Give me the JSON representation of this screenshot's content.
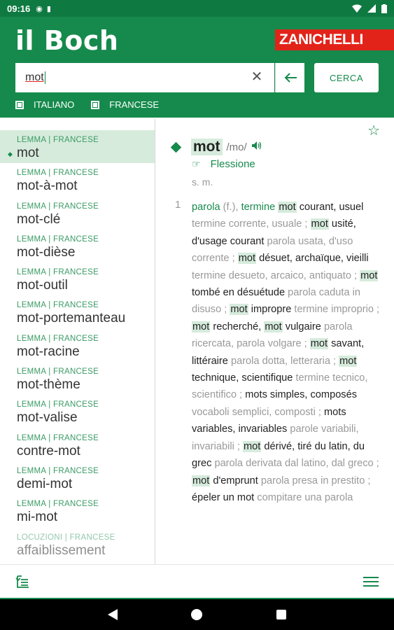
{
  "status_bar": {
    "time": "09:16"
  },
  "header": {
    "app_title": "il Boch",
    "brand": "ZANICHELLI",
    "search": {
      "value": "mot",
      "button_label": "CERCA"
    },
    "filters": [
      {
        "label": "ITALIANO"
      },
      {
        "label": "FRANCESE"
      }
    ]
  },
  "lemmas": [
    {
      "tag": "LEMMA | FRANCESE",
      "word": "mot",
      "active": true
    },
    {
      "tag": "LEMMA | FRANCESE",
      "word": "mot-à-mot"
    },
    {
      "tag": "LEMMA | FRANCESE",
      "word": "mot-clé"
    },
    {
      "tag": "LEMMA | FRANCESE",
      "word": "mot-dièse"
    },
    {
      "tag": "LEMMA | FRANCESE",
      "word": "mot-outil"
    },
    {
      "tag": "LEMMA | FRANCESE",
      "word": "mot-portemanteau"
    },
    {
      "tag": "LEMMA | FRANCESE",
      "word": "mot-racine"
    },
    {
      "tag": "LEMMA | FRANCESE",
      "word": "mot-thème"
    },
    {
      "tag": "LEMMA | FRANCESE",
      "word": "mot-valise"
    },
    {
      "tag": "LEMMA | FRANCESE",
      "word": "contre-mot"
    },
    {
      "tag": "LEMMA | FRANCESE",
      "word": "demi-mot"
    },
    {
      "tag": "LEMMA | FRANCESE",
      "word": "mi-mot"
    },
    {
      "tag": "LOCUZIONI | FRANCESE",
      "word": "affaiblissement"
    }
  ],
  "entry": {
    "headword": "mot",
    "pronunciation": "/mo/",
    "flexion_label": "Flessione",
    "grammar": "s. m.",
    "sense_number": "1",
    "sense_html_parts": [
      [
        "tr",
        "parola"
      ],
      [
        "g",
        " (f.), "
      ],
      [
        "tr",
        "termine"
      ],
      [
        "g",
        " "
      ],
      [
        "hl",
        "mot"
      ],
      [
        "b",
        " courant, usuel "
      ],
      [
        "g",
        "termine corrente, usuale"
      ],
      [
        "g",
        " ; "
      ],
      [
        "hl",
        "mot"
      ],
      [
        "b",
        " usité, d'usage courant "
      ],
      [
        "g",
        "parola usata, d'uso corrente"
      ],
      [
        "g",
        " ; "
      ],
      [
        "hl",
        "mot"
      ],
      [
        "b",
        " désuet, archaïque, vieilli "
      ],
      [
        "g",
        "termine desueto, arcaico, antiquato"
      ],
      [
        "g",
        " ; "
      ],
      [
        "hl",
        "mot"
      ],
      [
        "b",
        " tombé en désuétude "
      ],
      [
        "g",
        "parola caduta in disuso"
      ],
      [
        "g",
        " ; "
      ],
      [
        "hl",
        "mot"
      ],
      [
        "b",
        " impropre "
      ],
      [
        "g",
        "termine improprio"
      ],
      [
        "g",
        " ; "
      ],
      [
        "hl",
        "mot"
      ],
      [
        "b",
        " recherché, "
      ],
      [
        "hl",
        "mot"
      ],
      [
        "b",
        " vulgaire "
      ],
      [
        "g",
        "parola ricercata, parola volgare"
      ],
      [
        "g",
        " ; "
      ],
      [
        "hl",
        "mot"
      ],
      [
        "b",
        " savant, littéraire "
      ],
      [
        "g",
        "parola dotta, letteraria"
      ],
      [
        "g",
        " ; "
      ],
      [
        "hl",
        "mot"
      ],
      [
        "b",
        " technique, scientifique "
      ],
      [
        "g",
        "termine tecnico, scientifico"
      ],
      [
        "g",
        " ; "
      ],
      [
        "b",
        "mots simples, composés "
      ],
      [
        "g",
        "vocaboli semplici, composti"
      ],
      [
        "g",
        " ; "
      ],
      [
        "b",
        "mots variables, invariables "
      ],
      [
        "g",
        "parole variabili, invariabili"
      ],
      [
        "g",
        " ; "
      ],
      [
        "hl",
        "mot"
      ],
      [
        "b",
        " dérivé, tiré du latin, du grec "
      ],
      [
        "g",
        "parola derivata dal latino, dal greco"
      ],
      [
        "g",
        " ; "
      ],
      [
        "hl",
        "mot"
      ],
      [
        "b",
        " d'emprunt "
      ],
      [
        "g",
        "parola presa in prestito"
      ],
      [
        "g",
        " ; "
      ],
      [
        "b",
        "épeler un mot "
      ],
      [
        "g",
        "compitare una parola"
      ]
    ]
  }
}
